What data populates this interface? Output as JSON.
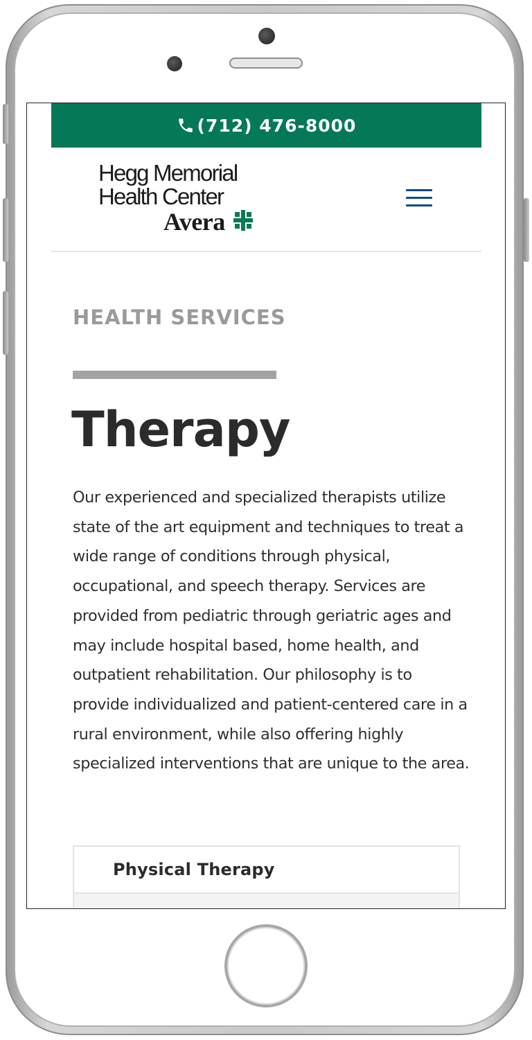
{
  "topbar": {
    "phone": "(712) 476-8000",
    "color": "#047857"
  },
  "logo": {
    "line1": "Hegg Memorial",
    "line2": "Health Center",
    "brand": "Avera"
  },
  "menu": {
    "icon": "hamburger-menu-icon",
    "color": "#0d4a8f"
  },
  "content": {
    "eyebrow": "HEALTH SERVICES",
    "title": "Therapy",
    "description": "Our experienced and specialized therapists utilize state of the art equipment and techniques to treat a wide range of conditions through physical, occupational, and speech therapy. Services are provided from pediatric through geriatric ages and may include hospital based, home health, and outpatient rehabilitation. Our philosophy is to provide individualized and patient-centered care in a rural environment, while also offering highly specialized interventions that are unique to the area."
  },
  "accordion": {
    "items": [
      {
        "label": "Physical Therapy"
      }
    ]
  }
}
